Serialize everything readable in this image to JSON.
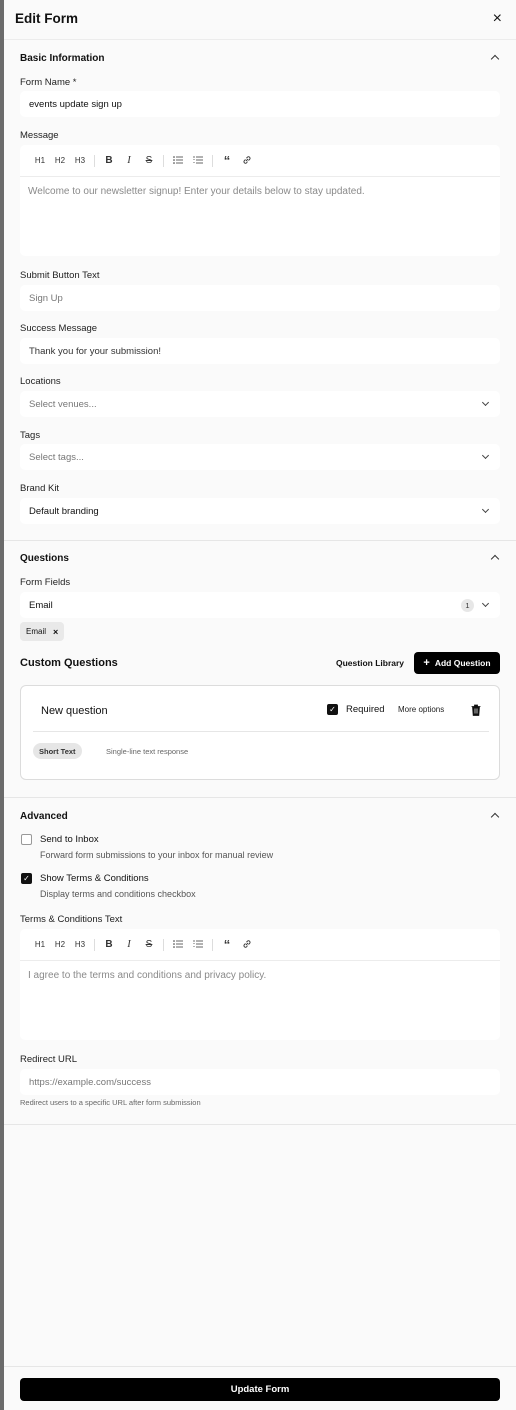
{
  "header": {
    "title": "Edit Form",
    "close": "×"
  },
  "basic": {
    "title": "Basic Information",
    "form_name_label": "Form Name *",
    "form_name_value": "events update sign up",
    "message_label": "Message",
    "message_placeholder": "Welcome to our newsletter signup! Enter your details below to stay updated.",
    "submit_label": "Submit Button Text",
    "submit_placeholder": "Sign Up",
    "success_label": "Success Message",
    "success_value": "Thank you for your submission!",
    "locations_label": "Locations",
    "locations_placeholder": "Select venues...",
    "tags_label": "Tags",
    "tags_placeholder": "Select tags...",
    "brand_label": "Brand Kit",
    "brand_value": "Default branding"
  },
  "toolbar": {
    "h1": "H1",
    "h2": "H2",
    "h3": "H3",
    "bold": "B",
    "italic": "I",
    "strike": "S",
    "quote": "“"
  },
  "questions": {
    "title": "Questions",
    "fields_label": "Form Fields",
    "fields_value": "Email",
    "fields_count": "1",
    "chip": "Email",
    "chip_remove": "×",
    "custom_title": "Custom Questions",
    "library": "Question Library",
    "add": "Add Question",
    "add_icon": "+",
    "card": {
      "title": "New question",
      "required": "Required",
      "more": "More options",
      "type": "Short Text",
      "type_desc": "Single-line text response",
      "check": "✓"
    }
  },
  "advanced": {
    "title": "Advanced",
    "inbox_title": "Send to Inbox",
    "inbox_desc": "Forward form submissions to your inbox for manual review",
    "terms_title": "Show Terms & Conditions",
    "terms_desc": "Display terms and conditions checkbox",
    "terms_check": "✓",
    "terms_text_label": "Terms & Conditions Text",
    "terms_placeholder": "I agree to the terms and conditions and privacy policy.",
    "redirect_label": "Redirect URL",
    "redirect_placeholder": "https://example.com/success",
    "redirect_hint": "Redirect users to a specific URL after form submission"
  },
  "footer": {
    "update": "Update Form"
  }
}
